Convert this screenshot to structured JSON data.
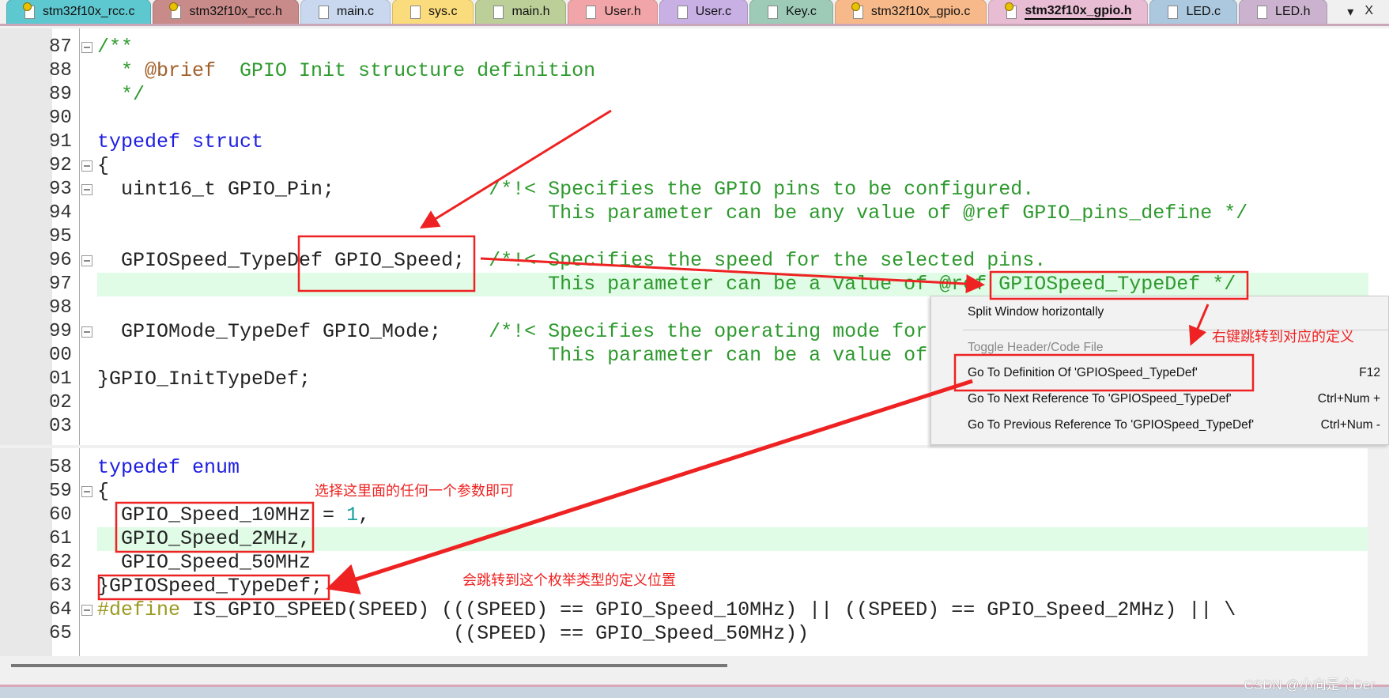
{
  "tabs": [
    {
      "label": "stm32f10x_rcc.c",
      "color": "#5ec8d0",
      "icon": "key-file-icon"
    },
    {
      "label": "stm32f10x_rcc.h",
      "color": "#c98a8a",
      "icon": "key-file-icon"
    },
    {
      "label": "main.c",
      "color": "#c9d8ef",
      "icon": "file-icon"
    },
    {
      "label": "sys.c",
      "color": "#fbdc7c",
      "icon": "file-icon"
    },
    {
      "label": "main.h",
      "color": "#bccf98",
      "icon": "file-icon"
    },
    {
      "label": "User.h",
      "color": "#f2a5a8",
      "icon": "file-icon"
    },
    {
      "label": "User.c",
      "color": "#c8b0e4",
      "icon": "file-icon"
    },
    {
      "label": "Key.c",
      "color": "#9dcbb8",
      "icon": "file-icon"
    },
    {
      "label": "stm32f10x_gpio.c",
      "color": "#f8b98a",
      "icon": "key-file-icon"
    },
    {
      "label": "stm32f10x_gpio.h",
      "color": "#e8bcd3",
      "icon": "key-file-icon",
      "active": true
    },
    {
      "label": "LED.c",
      "color": "#abc8de",
      "icon": "file-icon"
    },
    {
      "label": "LED.h",
      "color": "#cbb3cf",
      "icon": "file-icon"
    }
  ],
  "tab_controls": {
    "dropdown": "▾",
    "close": "X"
  },
  "top_pane": {
    "lines": [
      {
        "n": "87",
        "fold": true,
        "html": "<span class='cm'>/**</span>"
      },
      {
        "n": "88",
        "html": "<span class='cm'>  * </span><span class='at'>@brief</span><span class='cm'>  GPIO Init structure definition</span>"
      },
      {
        "n": "89",
        "html": "<span class='cm'>  */</span>"
      },
      {
        "n": "90",
        "html": ""
      },
      {
        "n": "91",
        "html": "<span class='kw'>typedef struct</span>"
      },
      {
        "n": "92",
        "fold": true,
        "html": "{"
      },
      {
        "n": "93",
        "fold": true,
        "html": "  uint16_t GPIO_Pin;             <span class='cm'>/*!&lt; Specifies the GPIO pins to be configured.</span>"
      },
      {
        "n": "94",
        "html": "<span class='cm'>                                      This parameter can be any value of @ref GPIO_pins_define */</span>"
      },
      {
        "n": "95",
        "html": ""
      },
      {
        "n": "96",
        "fold": true,
        "html": "  GPIOSpeed_TypeDef GPIO_Speed;  <span class='cm'>/*!&lt; Specifies the speed for the selected pins.</span>"
      },
      {
        "n": "97",
        "hl": true,
        "html": "<span class='cm'>                                      This parameter can be a value of @ref GPIOSpeed_TypeDef */</span>"
      },
      {
        "n": "98",
        "html": ""
      },
      {
        "n": "99",
        "fold": true,
        "html": "  GPIOMode_TypeDef GPIO_Mode;    <span class='cm'>/*!&lt; Specifies the operating mode for</span>"
      },
      {
        "n": "00",
        "html": "<span class='cm'>                                      This parameter can be a value of</span>"
      },
      {
        "n": "01",
        "html": "}GPIO_InitTypeDef;"
      },
      {
        "n": "02",
        "html": ""
      },
      {
        "n": "03",
        "html": ""
      }
    ]
  },
  "bottom_pane": {
    "lines": [
      {
        "n": "58",
        "html": "<span class='kw'>typedef enum</span>"
      },
      {
        "n": "59",
        "fold": true,
        "html": "{"
      },
      {
        "n": "60",
        "html": "  GPIO_Speed_10MHz = <span class='num'>1</span>,"
      },
      {
        "n": "61",
        "hl": true,
        "html": "  GPIO_Speed_2MHz,"
      },
      {
        "n": "62",
        "html": "  GPIO_Speed_50MHz"
      },
      {
        "n": "63",
        "html": "}GPIOSpeed_TypeDef;"
      },
      {
        "n": "64",
        "fold": true,
        "html": "<span class='pp'>#define</span> IS_GPIO_SPEED(SPEED) (((SPEED) == GPIO_Speed_10MHz) || ((SPEED) == GPIO_Speed_2MHz) || \\"
      },
      {
        "n": "65",
        "html": "                              ((SPEED) == GPIO_Speed_50MHz))"
      }
    ]
  },
  "context_menu": {
    "split": "Split Window horizontally",
    "toggle": "Toggle Header/Code File",
    "goto_def": "Go To Definition Of 'GPIOSpeed_TypeDef'",
    "goto_def_key": "F12",
    "next_ref": "Go To Next Reference To 'GPIOSpeed_TypeDef'",
    "next_ref_key": "Ctrl+Num +",
    "prev_ref": "Go To Previous Reference To 'GPIOSpeed_TypeDef'",
    "prev_ref_key": "Ctrl+Num -"
  },
  "annotations": {
    "right_click": "右键跳转到对应的定义",
    "select_any": "选择这里面的任何一个参数即可",
    "jump_to": "会跳转到这个枚举类型的定义位置"
  },
  "watermark": "CSDN @小向是个Der",
  "annotation_color": "#ee2222"
}
